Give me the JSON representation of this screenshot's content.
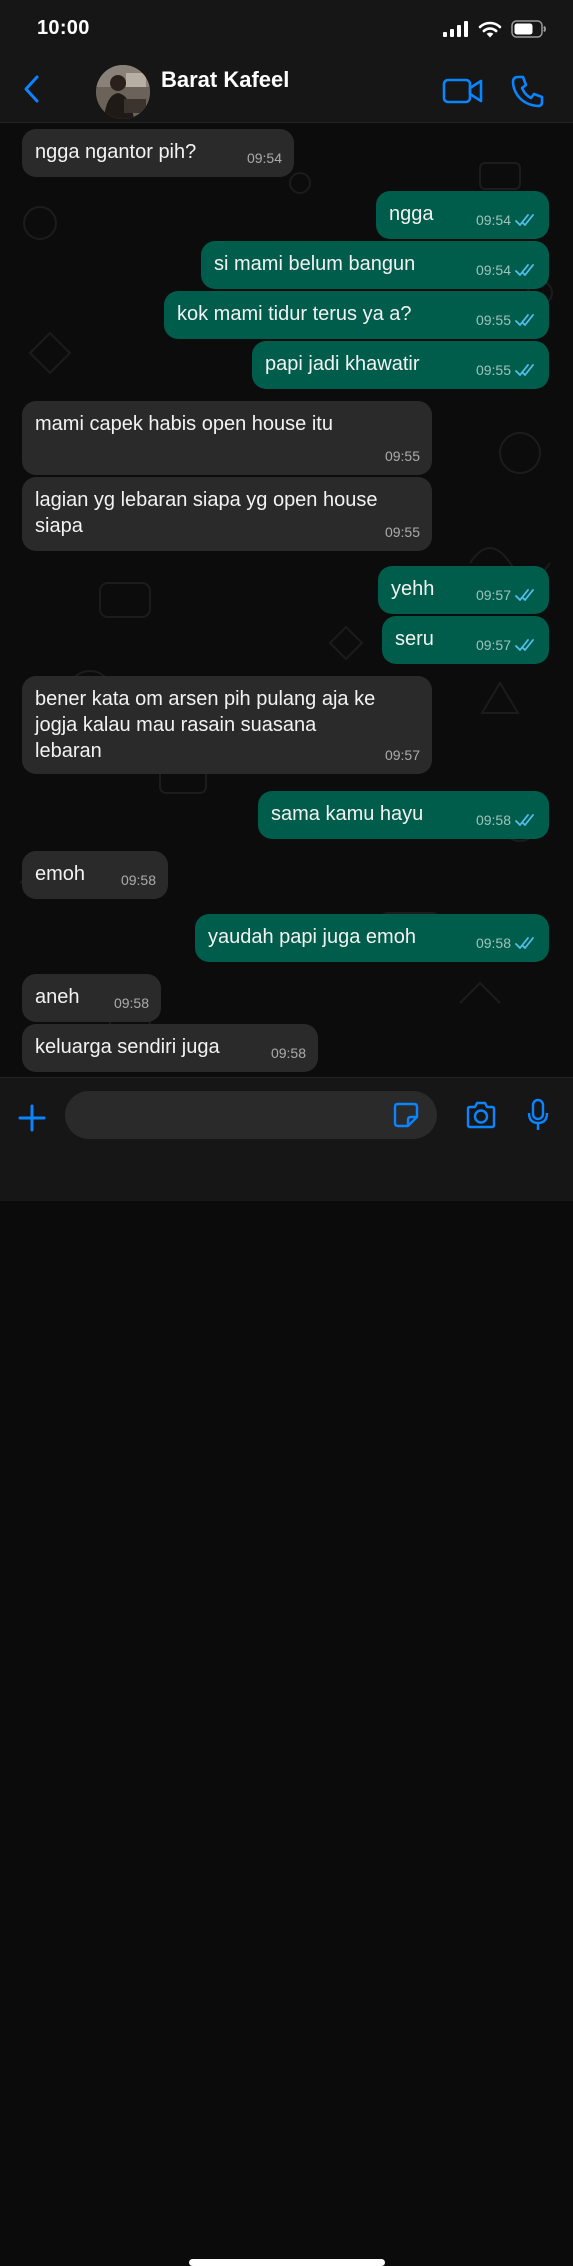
{
  "status_bar": {
    "time": "10:00"
  },
  "header": {
    "contact_name": "Barat Kafeel"
  },
  "colors": {
    "accent": "#0a84ff",
    "incoming_bubble": "#2a2a2b",
    "outgoing_bubble": "#005c4b",
    "read_ticks": "#53bdeb",
    "bar_background": "#161616"
  },
  "icons": {
    "back": "chevron-left-icon",
    "video": "video-camera-icon",
    "call": "phone-icon",
    "plus": "plus-icon",
    "sticker": "sticker-icon",
    "camera": "camera-icon",
    "mic": "microphone-icon",
    "read_receipt": "double-check-icon"
  },
  "messages": [
    {
      "direction": "in",
      "text": "ngga ngantor pih?",
      "time": "09:54"
    },
    {
      "direction": "out",
      "text": "ngga",
      "time": "09:54",
      "status": "read"
    },
    {
      "direction": "out",
      "text": "si mami belum bangun",
      "time": "09:54",
      "status": "read"
    },
    {
      "direction": "out",
      "text": "kok mami tidur terus ya a?",
      "time": "09:55",
      "status": "read"
    },
    {
      "direction": "out",
      "text": "papi jadi khawatir",
      "time": "09:55",
      "status": "read"
    },
    {
      "direction": "in",
      "text": "mami capek habis open house itu",
      "time": "09:55"
    },
    {
      "direction": "in",
      "text": "lagian yg lebaran siapa yg open house\nsiapa",
      "time": "09:55"
    },
    {
      "direction": "out",
      "text": "yehh",
      "time": "09:57",
      "status": "read"
    },
    {
      "direction": "out",
      "text": "seru",
      "time": "09:57",
      "status": "read"
    },
    {
      "direction": "in",
      "text": "bener kata om arsen pih pulang aja ke\njogja kalau mau rasain suasana\nlebaran",
      "time": "09:57"
    },
    {
      "direction": "out",
      "text": "sama kamu hayu",
      "time": "09:58",
      "status": "read"
    },
    {
      "direction": "in",
      "text": "emoh",
      "time": "09:58"
    },
    {
      "direction": "out",
      "text": "yaudah papi juga emoh",
      "time": "09:58",
      "status": "read"
    },
    {
      "direction": "in",
      "text": "aneh",
      "time": "09:58"
    },
    {
      "direction": "in",
      "text": "keluarga sendiri juga",
      "time": "09:58"
    }
  ],
  "composer": {
    "placeholder": "",
    "value": ""
  }
}
